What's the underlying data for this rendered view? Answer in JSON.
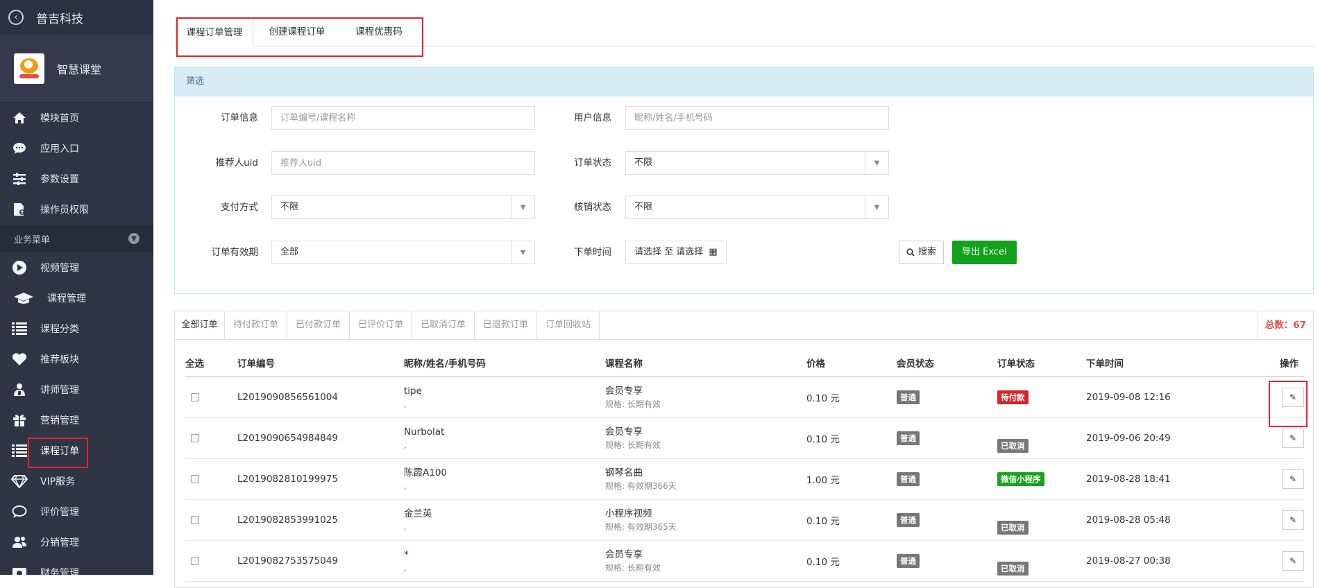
{
  "sidebar": {
    "brand": "普吉科技",
    "app_name": "智慧课堂",
    "top_items": [
      {
        "label": "模块首页",
        "icon": "home-icon"
      },
      {
        "label": "应用入口",
        "icon": "chat-icon"
      },
      {
        "label": "参数设置",
        "icon": "settings-list-icon"
      },
      {
        "label": "操作员权限",
        "icon": "document-user-icon"
      }
    ],
    "group_label": "业务菜单",
    "business_items": [
      {
        "label": "视频管理",
        "icon": "play-icon"
      },
      {
        "label": "课程管理",
        "icon": "graduation-cap-icon"
      },
      {
        "label": "课程分类",
        "icon": "list-icon"
      },
      {
        "label": "推荐板块",
        "icon": "heart-icon"
      },
      {
        "label": "讲师管理",
        "icon": "teacher-icon"
      },
      {
        "label": "营销管理",
        "icon": "gift-icon"
      },
      {
        "label": "课程订单",
        "icon": "order-list-icon"
      },
      {
        "label": "VIP服务",
        "icon": "diamond-icon"
      },
      {
        "label": "评价管理",
        "icon": "comment-icon"
      },
      {
        "label": "分销管理",
        "icon": "users-icon"
      },
      {
        "label": "财务管理",
        "icon": "finance-icon"
      }
    ]
  },
  "tabs": [
    "课程订单管理",
    "创建课程订单",
    "课程优惠码"
  ],
  "filter": {
    "title": "筛选",
    "order_info": {
      "label": "订单信息",
      "placeholder": "订单编号/课程名称"
    },
    "user_info": {
      "label": "用户信息",
      "placeholder": "昵称/姓名/手机号码"
    },
    "referrer": {
      "label": "推荐人uid",
      "placeholder": "推荐人uid"
    },
    "order_status": {
      "label": "订单状态",
      "value": "不限"
    },
    "pay_method": {
      "label": "支付方式",
      "value": "不限"
    },
    "verify_status": {
      "label": "核销状态",
      "value": "不限"
    },
    "validity": {
      "label": "订单有效期",
      "value": "全部"
    },
    "order_time": {
      "label": "下单时间",
      "value": "请选择 至 请选择"
    },
    "search_btn": "搜索",
    "export_btn": "导出 Excel"
  },
  "order_tabs": [
    "全部订单",
    "待付款订单",
    "已付款订单",
    "已评价订单",
    "已取消订单",
    "已退款订单",
    "订单回收站"
  ],
  "total_label": "总数：",
  "total_value": "67",
  "table": {
    "headers": [
      "全选",
      "订单编号",
      "昵称/姓名/手机号码",
      "课程名称",
      "价格",
      "会员状态",
      "订单状态",
      "下单时间",
      "操作"
    ],
    "rows": [
      {
        "order_no": "L2019090856561004",
        "nick": "tipe",
        "nick2": ",",
        "course": "会员专享",
        "spec": "规格: 长期有效",
        "price": "0.10 元",
        "member": "普通",
        "status": "待付款",
        "status_color": "#d9232b",
        "time": "2019-09-08 12:16"
      },
      {
        "order_no": "L2019090654984849",
        "nick": "Nurbolat",
        "nick2": ",",
        "course": "会员专享",
        "spec": "规格: 长期有效",
        "price": "0.10 元",
        "member": "普通",
        "status": "已取消",
        "status_color": "#777777",
        "time": "2019-09-06 20:49"
      },
      {
        "order_no": "L2019082810199975",
        "nick": "陈霞A100",
        "nick2": ",",
        "course": "钢琴名曲",
        "spec": "规格: 有效期366天",
        "price": "1.00 元",
        "member": "普通",
        "status": "微信小程序",
        "status_color": "#1aa31f",
        "time": "2019-08-28 18:41"
      },
      {
        "order_no": "L2019082853991025",
        "nick": "金兰英",
        "nick2": ",",
        "course": "小程序视频",
        "spec": "规格: 有效期365天",
        "price": "0.10 元",
        "member": "普通",
        "status": "已取消",
        "status_color": "#777777",
        "time": "2019-08-28 05:48"
      },
      {
        "order_no": "L2019082753575049",
        "nick": "*",
        "nick2": ",",
        "course": "会员专享",
        "spec": "规格: 长期有效",
        "price": "0.10 元",
        "member": "普通",
        "status": "已取消",
        "status_color": "#777777",
        "time": "2019-08-27 00:38"
      }
    ]
  },
  "colors": {
    "sidebar_bg": "#2f3545",
    "accent_red": "#e0242b",
    "export_green": "#11a11a",
    "filter_head_bg": "#d9edf7"
  }
}
